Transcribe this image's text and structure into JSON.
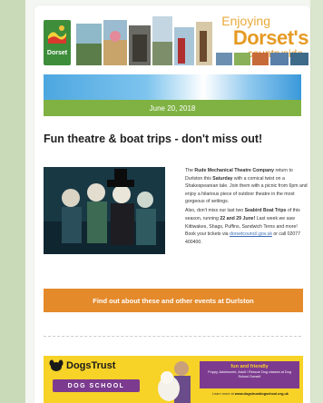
{
  "header": {
    "logo_text": "Dorset",
    "title_line1": "Enjoying",
    "title_line2": "Dorset's",
    "title_line3": "countryside"
  },
  "date_bar": {
    "text": "June 20, 2018"
  },
  "article": {
    "headline": "Fun theatre & boat trips - don't miss out!",
    "para1": {
      "pre": "The ",
      "strong1": "Rude Mechanical Theatre Company",
      "mid1": " return to Durlston this ",
      "strong2": "Saturday",
      "post": " with a comical twist on a Shakespearean tale. Join them with a picnic from 6pm and enjoy a hilarious piece of outdoor theatre in the most gorgeous of settings."
    },
    "para2": {
      "pre": "Also, don't miss our last two ",
      "strong1": "Seabird Boat Trips",
      "mid1": " of this season, running ",
      "strong2": "22 and 29 June!",
      "mid2": " Last week we saw Kittiwakes, Shags, Puffins, Sandwich Terns and more! Book your tickets via ",
      "link": "dorsetcouncil.gov.uk",
      "post": " or call 02077 400400."
    },
    "cta_label": "Find out about these and other events at Durlston"
  },
  "ad": {
    "brand": "DogsTrust",
    "pill": "DOG SCHOOL",
    "box_heading": "fun and friendly",
    "box_sub": "Puppy, Adolescent, Adult / Rescue Dog classes at Dog School Dorset!",
    "url_prefix": "Learn more at ",
    "url": "www.dogstrustdogschool.org.uk"
  },
  "colors": {
    "accent_orange": "#e48a2b",
    "date_green": "#7fb243",
    "logo_green": "#3e8d3a",
    "ad_yellow": "#f7d227",
    "ad_purple": "#7c3b8f"
  }
}
